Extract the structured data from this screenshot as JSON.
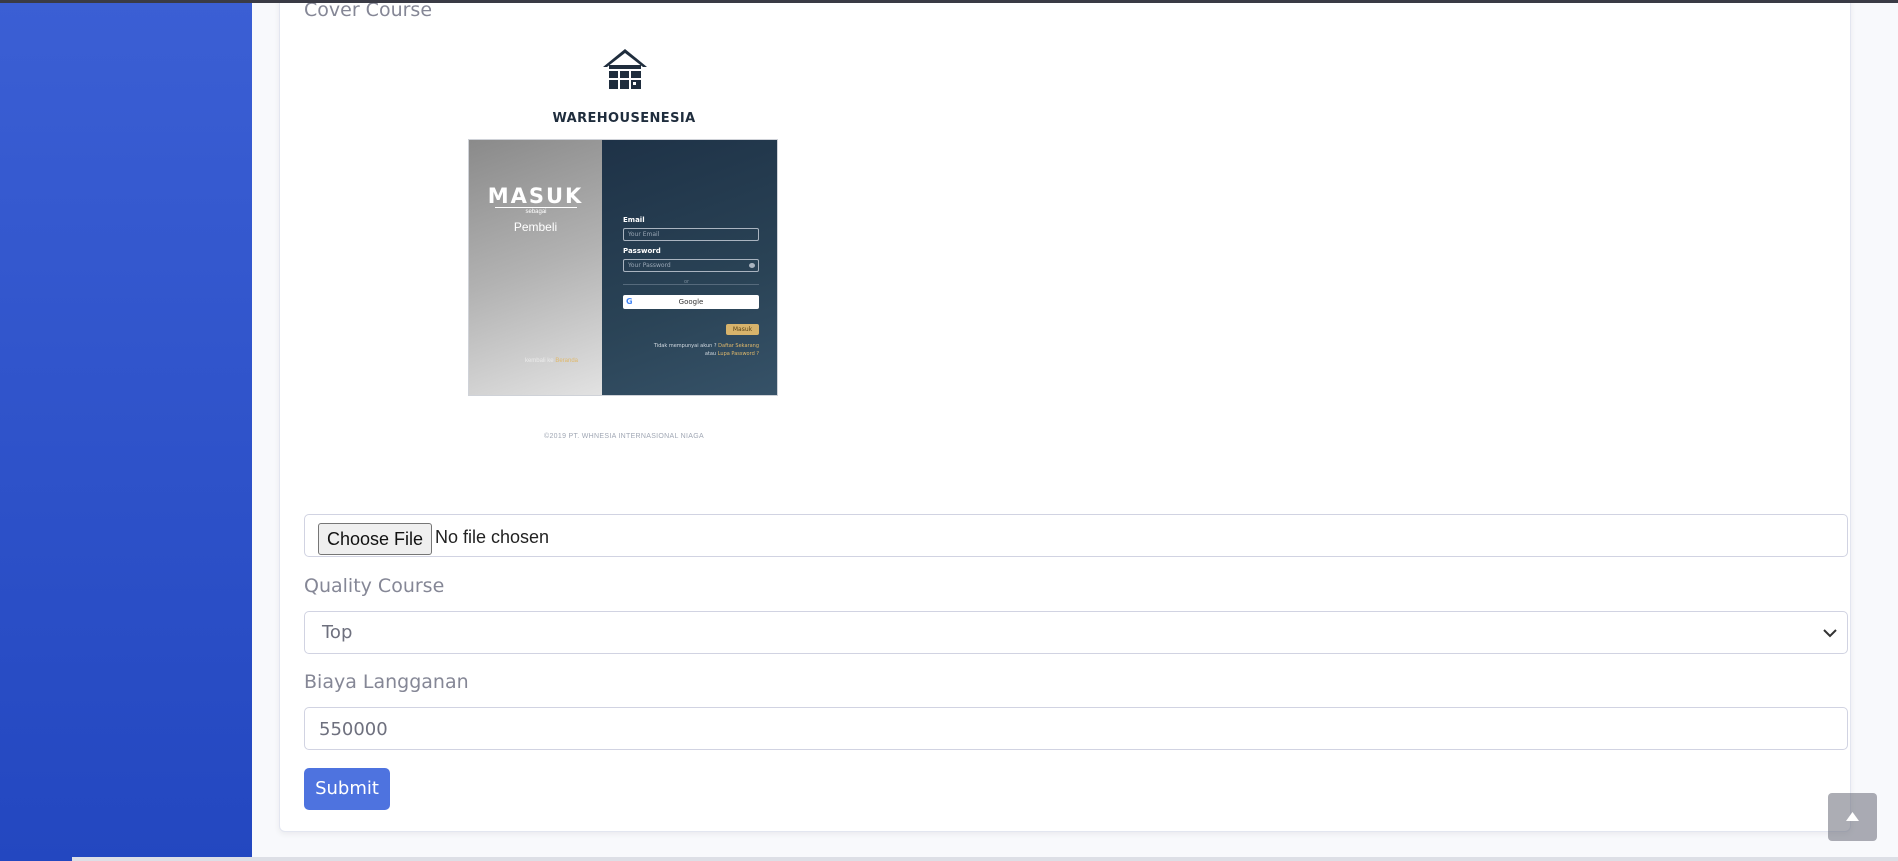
{
  "form": {
    "cover_label": "Cover Course",
    "file_button": "Choose File",
    "file_status": "No file chosen",
    "quality_label": "Quality Course",
    "quality_value": "Top",
    "price_label": "Biaya Langganan",
    "price_value": "550000",
    "submit_label": "Submit"
  },
  "cover": {
    "brand": "WAREHOUSENESIA",
    "masuk_title": "MASUK",
    "sebagai": "sebagai",
    "pembeli": "Pembeli",
    "kembali_prefix": "kembali ke",
    "kembali_link": "Beranda",
    "email_label": "Email",
    "email_placeholder": "Your Email",
    "password_label": "Password",
    "password_placeholder": "Your Password",
    "or_text": "or",
    "google_label": "Google",
    "masuk_btn": "Masuk",
    "no_account": "Tidak mempunyai akun ?",
    "register_link": "Daftar Sekarang",
    "atau": "atau",
    "forgot_link": "Lupa Password ?",
    "copyright": "©2019 PT. WHNESIA INTERNASIONAL NIAGA"
  },
  "colors": {
    "sidebar_top": "#3b5fd4",
    "sidebar_bottom": "#2347c0",
    "submit_button": "#4e73df",
    "label_text": "#858796"
  },
  "icons": {
    "select_arrow": "chevron-down-icon",
    "scroll_top": "chevron-up-icon",
    "logo": "warehouse-house-icon"
  }
}
